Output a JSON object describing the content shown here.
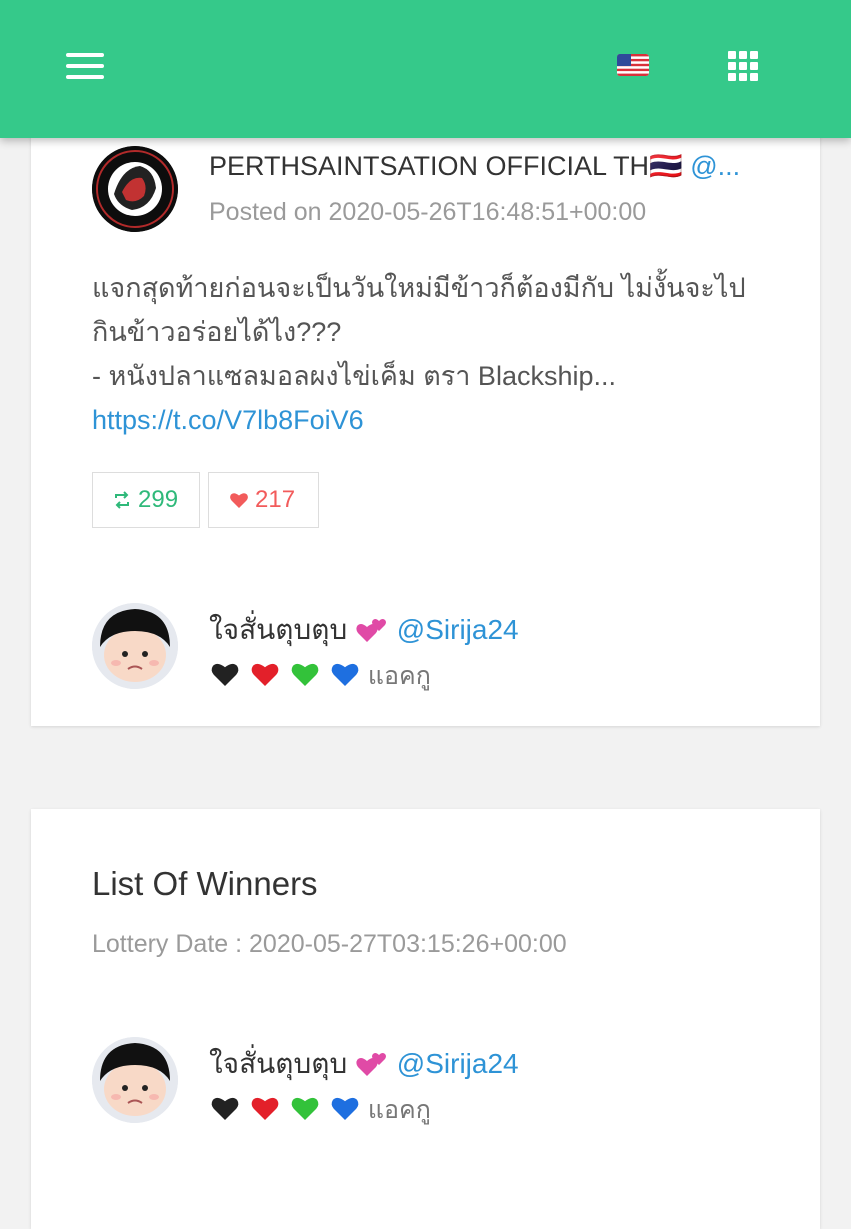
{
  "header": {
    "menu_icon": "hamburger-menu-icon",
    "language_icon": "us-flag-icon",
    "apps_icon": "grid-apps-icon",
    "color": "#35c98a"
  },
  "post": {
    "author_name": "PERTHSAINTSATION OFFICIAL TH🇹🇭",
    "author_handle": "@...",
    "posted_on": "Posted on 2020-05-26T16:48:51+00:00",
    "text_line1": "แจกสุดท้ายก่อนจะเป็นวันใหม่มีข้าวก็ต้องมีกับ ไม่งั้นจะไป",
    "text_line2": "กินข้าวอร่อยได้ไง???",
    "text_line3": "- หนังปลาแซลมอลผงไข่เค็ม ตรา Blackship...",
    "link": "https://t.co/V7lb8FoiV6",
    "retweets": "299",
    "likes": "217"
  },
  "participant": {
    "name": "ใจสั่นตุบตุบ",
    "handle": "@Sirija24",
    "bio": "แอคกู"
  },
  "winners": {
    "title": "List Of Winners",
    "lottery_date": "Lottery Date : 2020-05-27T03:15:26+00:00",
    "winner": {
      "name": "ใจสั่นตุบตุบ",
      "handle": "@Sirija24",
      "bio": "แอคกู"
    }
  }
}
